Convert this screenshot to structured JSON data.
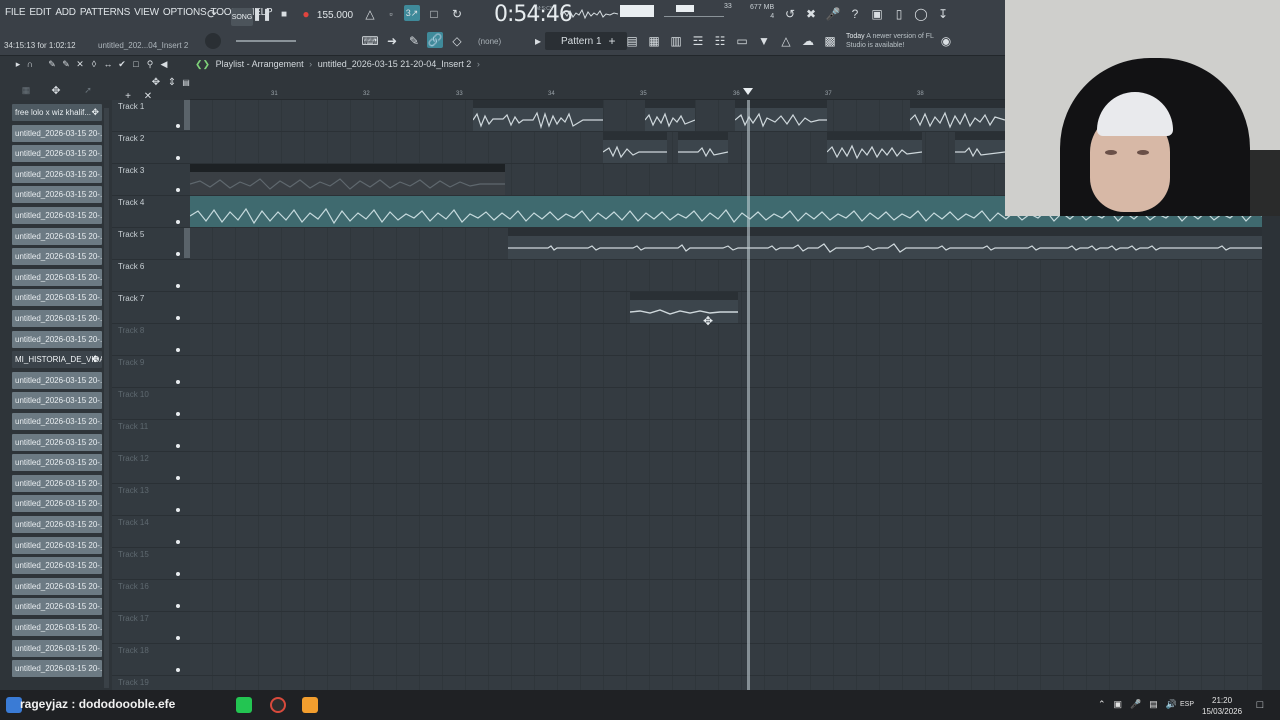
{
  "menu": [
    "FILE",
    "EDIT",
    "ADD",
    "PATTERNS",
    "VIEW",
    "OPTIONS",
    "TOOLS",
    "HELP"
  ],
  "toolbar": {
    "song_label": "SONG",
    "tempo": "155.000",
    "time": "0:54:46",
    "time_unit": "M:S:CS",
    "hint": "34:15:13 for 1:02:12",
    "project_name": "untitled_202...04_Insert 2",
    "cpu_value": "33",
    "memory": "677 MB",
    "voices": "4",
    "pattern": "Pattern 1",
    "channel_filter": "(none)",
    "news_date": "Today",
    "news_text": "A newer version of FL Studio is available!"
  },
  "playlist": {
    "window_title": "Playlist - Arrangement",
    "breadcrumb": "untitled_2026-03-15 21-20-04_Insert 2",
    "ruler_numbers": [
      "31",
      "32",
      "33",
      "34",
      "35",
      "36",
      "37",
      "38"
    ]
  },
  "browser_items": [
    "free lolo x wiz khalif...",
    "untitled_2026-03-15 20-...",
    "untitled_2026-03-15 20-...",
    "untitled_2026-03-15 20-...",
    "untitled_2026-03-15 20-...",
    "untitled_2026-03-15 20-...",
    "untitled_2026-03-15 20-...",
    "untitled_2026-03-15 20-...",
    "untitled_2026-03-15 20-...",
    "untitled_2026-03-15 20-...",
    "untitled_2026-03-15 20-...",
    "untitled_2026-03-15 20-...",
    "MI_HISTORIA_DE_VIDA",
    "untitled_2026-03-15 20-...",
    "untitled_2026-03-15 20-...",
    "untitled_2026-03-15 20-...",
    "untitled_2026-03-15 20-...",
    "untitled_2026-03-15 20-...",
    "untitled_2026-03-15 20-...",
    "untitled_2026-03-15 20-...",
    "untitled_2026-03-15 20-...",
    "untitled_2026-03-15 20-...",
    "untitled_2026-03-15 20-...",
    "untitled_2026-03-15 20-...",
    "untitled_2026-03-15 20-...",
    "untitled_2026-03-15 20-...",
    "untitled_2026-03-15 20-...",
    "untitled_2026-03-15 20-..."
  ],
  "tracks": [
    "Track 1",
    "Track 2",
    "Track 3",
    "Track 4",
    "Track 5",
    "Track 6",
    "Track 7",
    "Track 8",
    "Track 9",
    "Track 10",
    "Track 11",
    "Track 12",
    "Track 13",
    "Track 14",
    "Track 15",
    "Track 16",
    "Track 17",
    "Track 18",
    "Track 19"
  ],
  "clips": {
    "t1a": "untitled_2026-03-15 20-56-10_Insert 2",
    "t1b": "untitl...sert 2",
    "t1c": "untitled_2026...7-10_Insert 2",
    "t1d": "untitled_2026-...57-53_Insert 2",
    "t2a": "untitled_...Insert 2",
    "t2b": "untitl...sert 2",
    "t2c": "untitled_2026...-30_Insert 2",
    "t2d": "untitled_2026",
    "t3": "MI_HISTORIA_DE_VIDA",
    "t4": "free lolo x wiz khalifa x rageylo type beat - eyes - metometoelyn",
    "t5": "untitled_2026-03-15 21-17-44_Insert 2",
    "t7": "untitled_2026-0..20-04_Insert 2"
  },
  "taskbar": {
    "search_text": "rageyjaz : dododoooble.efe",
    "language": "ESP",
    "time": "21:20",
    "date": "15/03/2026"
  }
}
